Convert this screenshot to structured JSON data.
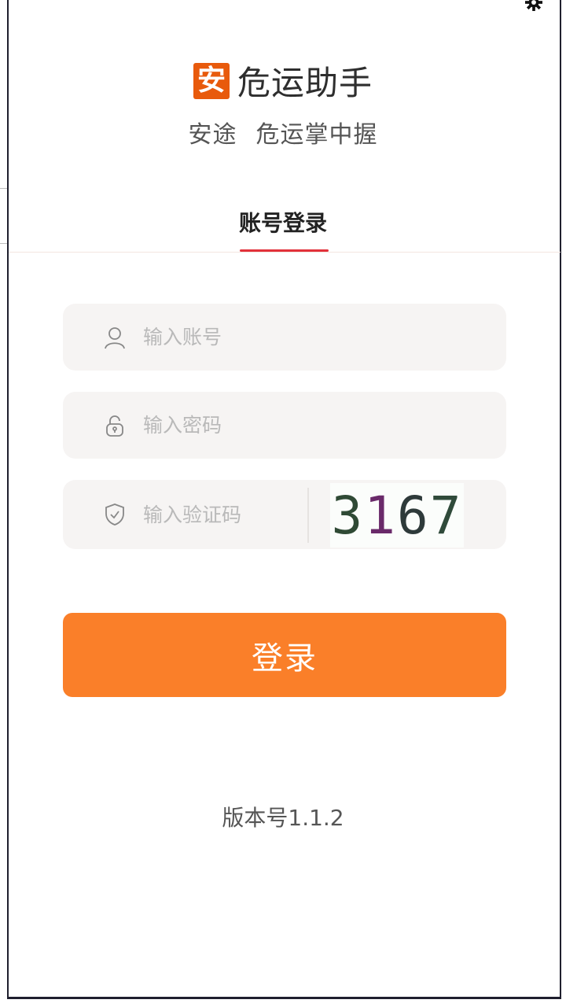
{
  "header": {
    "logo_glyph": "安",
    "app_name": "危运助手",
    "slogan_part1": "安途",
    "slogan_part2": "危运掌中握"
  },
  "tabs": [
    {
      "label": "账号登录",
      "active": true
    }
  ],
  "form": {
    "account_placeholder": "输入账号",
    "password_placeholder": "输入密码",
    "captcha_placeholder": "输入验证码",
    "captcha_chars": [
      "3",
      "1",
      "6",
      "7"
    ],
    "login_label": "登录"
  },
  "footer": {
    "version": "版本号1.1.2"
  },
  "icons": {
    "settings": "gear-icon",
    "account": "user-icon",
    "password": "lock-icon",
    "captcha": "shield-check-icon"
  },
  "colors": {
    "accent": "#fa7f29",
    "logo_bg": "#e85a0c",
    "tab_underline": "#e2313a",
    "field_bg": "#f6f4f3"
  }
}
